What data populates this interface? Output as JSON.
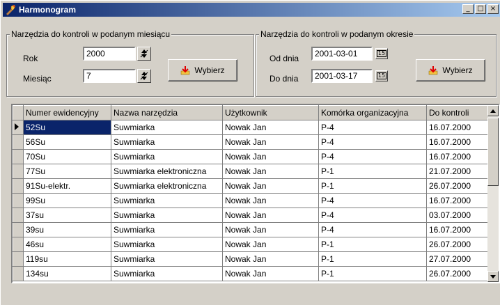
{
  "window": {
    "title": "Harmonogram",
    "minimize_glyph": "_",
    "maximize_glyph": "□",
    "close_glyph": "×"
  },
  "month_group": {
    "title": "Narzędzia do kontroli w podanym miesiącu",
    "year_label": "Rok",
    "year_value": "2000",
    "month_label": "Miesiąc",
    "month_value": "7",
    "button_label": "Wybierz",
    "button_icon": "arrow-down-icon"
  },
  "period_group": {
    "title": "Narzędzia do kontroli w podanym okresie",
    "from_label": "Od dnia",
    "from_value": "2001-03-01",
    "to_label": "Do dnia",
    "to_value": "2001-03-17",
    "calendar_glyph": "15",
    "button_label": "Wybierz",
    "button_icon": "arrow-down-icon"
  },
  "grid": {
    "columns": [
      "Numer ewidencyjny",
      "Nazwa narzędzia",
      "Użytkownik",
      "Komórka organizacyjna",
      "Do kontroli"
    ],
    "rows": [
      [
        "52Su",
        "Suwmiarka",
        "Nowak Jan",
        "P-4",
        "16.07.2000"
      ],
      [
        "56Su",
        "Suwmiarka",
        "Nowak Jan",
        "P-4",
        "16.07.2000"
      ],
      [
        "70Su",
        "Suwmiarka",
        "Nowak Jan",
        "P-4",
        "16.07.2000"
      ],
      [
        "77Su",
        "Suwmiarka elektroniczna",
        "Nowak Jan",
        "P-1",
        "21.07.2000"
      ],
      [
        "91Su-elektr.",
        "Suwmiarka elektroniczna",
        "Nowak Jan",
        "P-1",
        "26.07.2000"
      ],
      [
        "99Su",
        "Suwmiarka",
        "Nowak Jan",
        "P-4",
        "16.07.2000"
      ],
      [
        "37su",
        "Suwmiarka",
        "Nowak Jan",
        "P-4",
        "03.07.2000"
      ],
      [
        "39su",
        "Suwmiarka",
        "Nowak Jan",
        "P-4",
        "16.07.2000"
      ],
      [
        "46su",
        "Suwmiarka",
        "Nowak Jan",
        "P-1",
        "26.07.2000"
      ],
      [
        "119su",
        "Suwmiarka",
        "Nowak Jan",
        "P-1",
        "27.07.2000"
      ],
      [
        "134su",
        "Suwmiarka",
        "Nowak Jan",
        "P-1",
        "26.07.2000"
      ]
    ],
    "selected_row": 0
  },
  "colors": {
    "title_start": "#0a246a",
    "title_end": "#a6caf0",
    "face": "#d4d0c8"
  }
}
